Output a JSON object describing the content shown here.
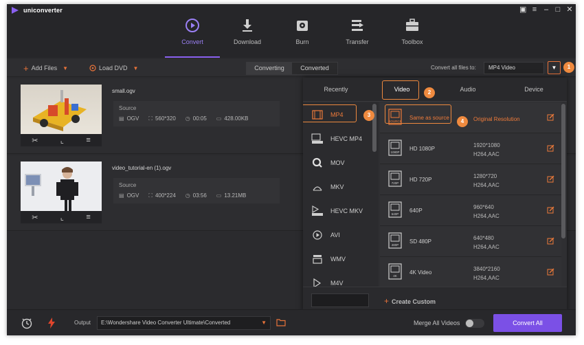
{
  "app": {
    "title": "uniconverter"
  },
  "window_controls": [
    "chat-icon",
    "menu-icon",
    "minimize-icon",
    "maximize-icon",
    "close-icon"
  ],
  "nav": [
    {
      "label": "Convert",
      "icon": "convert-icon",
      "active": true
    },
    {
      "label": "Download",
      "icon": "download-icon"
    },
    {
      "label": "Burn",
      "icon": "disc-icon"
    },
    {
      "label": "Transfer",
      "icon": "transfer-icon"
    },
    {
      "label": "Toolbox",
      "icon": "toolbox-icon"
    }
  ],
  "toolbar": {
    "add_files": "Add Files",
    "load_dvd": "Load DVD",
    "converting": "Converting",
    "converted": "Converted",
    "convert_all_label": "Convert all files to:",
    "format_value": "MP4 Video"
  },
  "files": [
    {
      "name": "small.ogv",
      "source_label": "Source",
      "format": "OGV",
      "resolution": "560*320",
      "duration": "00:05",
      "size": "428.00KB"
    },
    {
      "name": "video_tutorial-en (1).ogv",
      "source_label": "Source",
      "format": "OGV",
      "resolution": "400*224",
      "duration": "03:56",
      "size": "13.21MB"
    }
  ],
  "popup": {
    "tabs": [
      "Recently",
      "Video",
      "Audio",
      "Device"
    ],
    "active_tab": "Video",
    "formats": [
      {
        "label": "MP4",
        "icon": "mp4-icon",
        "selected": true
      },
      {
        "label": "HEVC MP4",
        "icon": "hevc-mp4-icon"
      },
      {
        "label": "MOV",
        "icon": "mov-icon"
      },
      {
        "label": "MKV",
        "icon": "mkv-icon"
      },
      {
        "label": "HEVC MKV",
        "icon": "hevc-mkv-icon"
      },
      {
        "label": "AVI",
        "icon": "avi-icon"
      },
      {
        "label": "WMV",
        "icon": "wmv-icon"
      },
      {
        "label": "M4V",
        "icon": "m4v-icon"
      }
    ],
    "resolutions": [
      {
        "name": "Same as source",
        "badge": "SOURCE",
        "detail": "Original Resolution",
        "selected": true
      },
      {
        "name": "HD 1080P",
        "badge": "1080P",
        "res": "1920*1080",
        "codec": "H264,AAC"
      },
      {
        "name": "HD 720P",
        "badge": "720P",
        "res": "1280*720",
        "codec": "H264,AAC"
      },
      {
        "name": "640P",
        "badge": "640P",
        "res": "960*640",
        "codec": "H264,AAC"
      },
      {
        "name": "SD 480P",
        "badge": "480P",
        "res": "640*480",
        "codec": "H264,AAC"
      },
      {
        "name": "4K Video",
        "badge": "4K",
        "res": "3840*2160",
        "codec": "H264,AAC"
      }
    ],
    "search_placeholder": "",
    "create_custom": "Create Custom"
  },
  "callouts": [
    "1",
    "2",
    "3",
    "4"
  ],
  "bottom": {
    "output_label": "Output",
    "output_path": "E:\\Wondershare Video Converter Ultimate\\Converted",
    "merge_label": "Merge All Videos",
    "merge_on": false,
    "convert_all": "Convert All"
  },
  "colors": {
    "accent": "#ef8a3f",
    "primary": "#7b50e6",
    "nav_active": "#9b80f5"
  }
}
